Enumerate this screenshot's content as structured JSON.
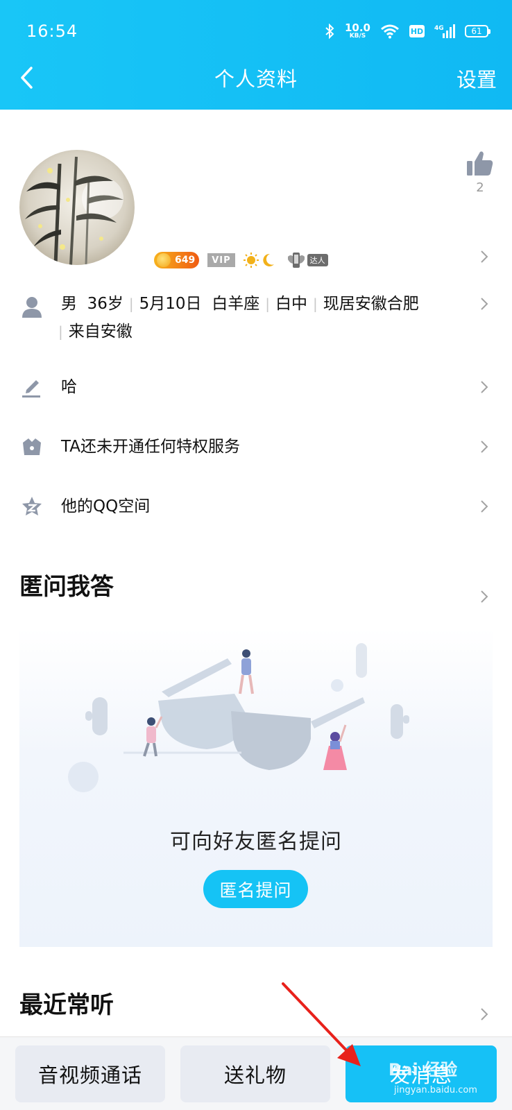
{
  "status_bar": {
    "time": "16:54",
    "net_speed_value": "10.0",
    "net_speed_unit": "KB/S",
    "hd_label": "HD",
    "signal_label": "4G",
    "battery": "61",
    "icons": [
      "bluetooth-icon",
      "wifi-icon",
      "hd-icon",
      "signal-icon",
      "battery-icon"
    ]
  },
  "nav": {
    "title": "个人资料",
    "settings_label": "设置",
    "back_icon": "chevron-left-icon"
  },
  "profile": {
    "like_count": "2",
    "badges": {
      "level_value": "649",
      "vip_label": "VIP",
      "daren_label": "达人"
    },
    "info": {
      "gender": "男",
      "age": "36岁",
      "birthday": "5月10日",
      "zodiac": "白羊座",
      "blood": "白中",
      "residence": "现居安徽合肥",
      "hometown": "来自安徽"
    },
    "signature": "哈",
    "privilege": "TA还未开通任何特权服务",
    "qzone": "他的QQ空间"
  },
  "sections": {
    "anonymous_qa": {
      "title": "匿问我答",
      "prompt": "可向好友匿名提问",
      "button_label": "匿名提问"
    },
    "recent_listen": {
      "title": "最近常听"
    }
  },
  "bottom_bar": {
    "call_label": "音视频通话",
    "gift_label": "送礼物",
    "message_label": "发消息"
  },
  "watermark": {
    "brand": "Bai 经验",
    "url": "jingyan.baidu.com"
  },
  "colors": {
    "header": "#13bff5",
    "accent": "#16c1f6",
    "arrow": "#e8211b"
  }
}
